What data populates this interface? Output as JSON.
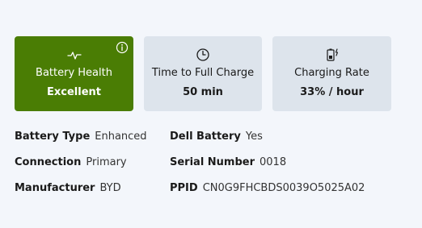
{
  "cards": [
    {
      "icon": "pulse-icon",
      "title": "Battery Health",
      "value": "Excellent",
      "info_icon": "info-icon",
      "bg": "#4a7d04",
      "text_color": "#ffffff"
    },
    {
      "icon": "clock-icon",
      "title": "Time to Full Charge",
      "value": "50 min",
      "bg": "#dde4ec"
    },
    {
      "icon": "battery-charging-icon",
      "title": "Charging Rate",
      "value": "33% / hour",
      "bg": "#dde4ec"
    }
  ],
  "details": {
    "battery_type": {
      "label": "Battery Type",
      "value": "Enhanced"
    },
    "connection": {
      "label": "Connection",
      "value": "Primary"
    },
    "manufacturer": {
      "label": "Manufacturer",
      "value": "BYD"
    },
    "dell_battery": {
      "label": "Dell Battery",
      "value": "Yes"
    },
    "serial_number": {
      "label": "Serial Number",
      "value": "0018"
    },
    "ppid": {
      "label": "PPID",
      "value": "CN0G9FHCBDS0039O5025A02"
    }
  },
  "colors": {
    "background": "#f3f6fb",
    "accent_green": "#4a7d04",
    "card_gray": "#dde4ec"
  }
}
